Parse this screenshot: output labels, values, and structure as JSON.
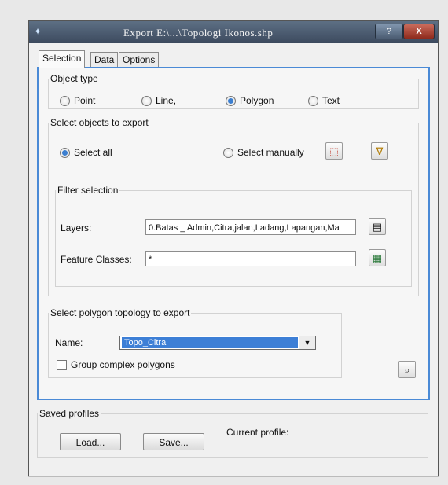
{
  "window": {
    "title": "Export   E:\\...\\Topologi Ikonos.shp",
    "help_label": "?",
    "close_label": "X",
    "app_icon": "arcmap-icon"
  },
  "tabs": [
    {
      "label": "Selection",
      "active": true
    },
    {
      "label": "Data",
      "active": false
    },
    {
      "label": "Options",
      "active": false
    }
  ],
  "object_type": {
    "legend": "Object type",
    "options": [
      {
        "label": "Point",
        "selected": false
      },
      {
        "label": "Line,",
        "selected": false
      },
      {
        "label": "Polygon",
        "selected": true
      },
      {
        "label": "Text",
        "selected": false
      }
    ]
  },
  "select_objects": {
    "legend": "Select objects to export",
    "select_all_label": "Select all",
    "select_manually_label": "Select manually",
    "select_all_selected": true,
    "select_manually_selected": false,
    "filter": {
      "legend": "Filter selection",
      "layers_label": "Layers:",
      "layers_value": "0.Batas _ Admin,Citra,jalan,Ladang,Lapangan,Ma",
      "feature_classes_label": "Feature Classes:",
      "feature_classes_value": "*"
    }
  },
  "topology": {
    "legend": "Select polygon topology to export",
    "name_label": "Name:",
    "name_value": "Topo_Citra",
    "group_complex_label": "Group complex polygons",
    "group_complex_checked": false
  },
  "saved_profiles": {
    "legend": "Saved profiles",
    "load_label": "Load...",
    "save_label": "Save...",
    "current_profile_label": "Current profile:"
  },
  "colors": {
    "accent": "#4a8ad6",
    "selection": "#3d7fd6"
  }
}
